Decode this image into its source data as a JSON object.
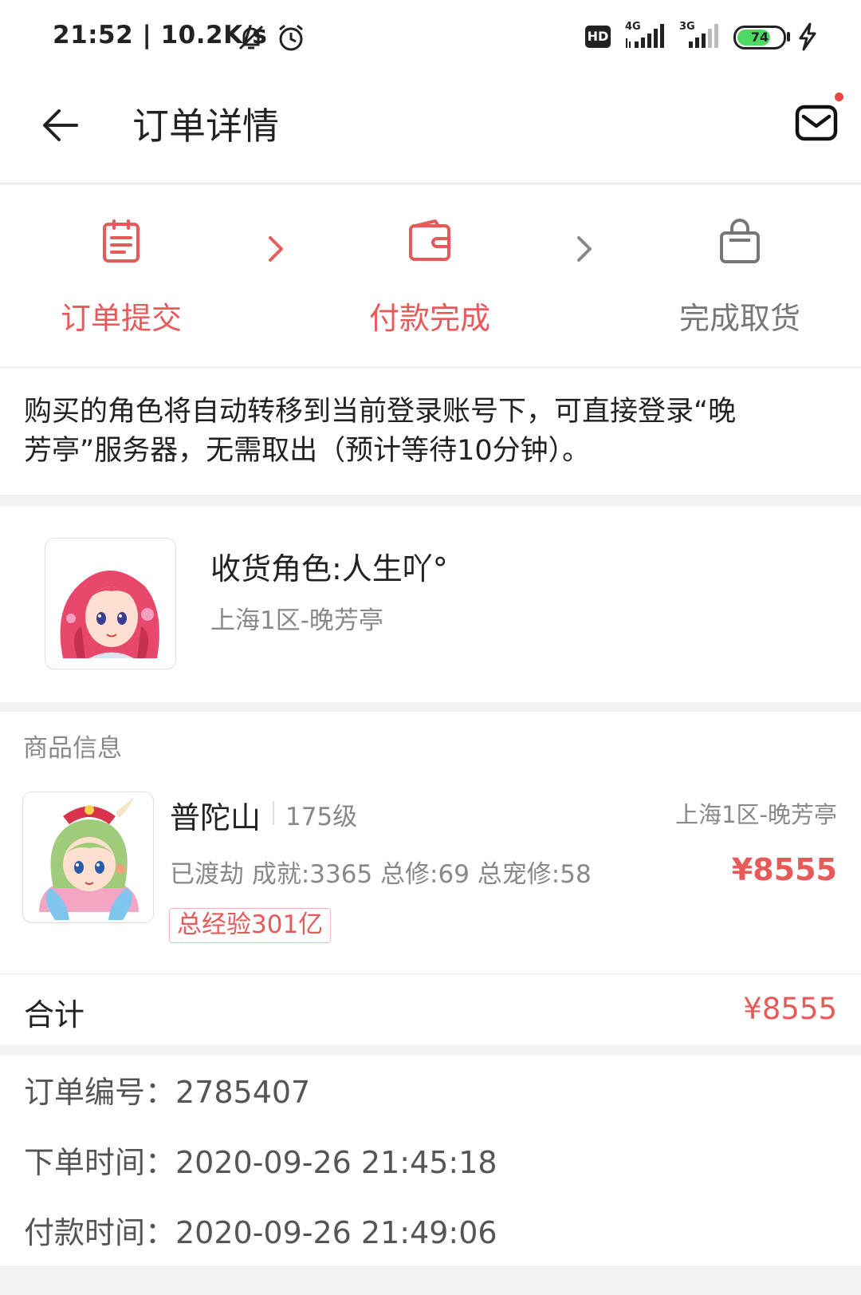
{
  "status_bar": {
    "time_speed": "21:52 | 10.2K/s",
    "battery": "74",
    "hd": "HD",
    "net1": "4G",
    "net2": "3G",
    "icons": [
      "mute-bell-icon",
      "alarm-icon",
      "hd-icon",
      "signal-4g-icon",
      "signal-3g-icon",
      "battery-icon",
      "charging-icon"
    ]
  },
  "header": {
    "title": "订单详情",
    "icons": [
      "back-arrow-icon",
      "mail-icon"
    ]
  },
  "steps": [
    {
      "label": "订单提交",
      "icon": "order-list-icon",
      "active": true
    },
    {
      "label": "付款完成",
      "icon": "wallet-icon",
      "active": true
    },
    {
      "label": "完成取货",
      "icon": "bag-icon",
      "active": false
    }
  ],
  "colors": {
    "accent": "#e85a5a",
    "muted": "#888888",
    "background": "#f2f2f2"
  },
  "notice": {
    "line1": "购买的角色将自动转移到当前登录账号下，可直接登录“晚",
    "line2": "芳亭”服务器，无需取出（预计等待10分钟）。"
  },
  "receiver": {
    "name": "收货角色:人生吖°",
    "server": "上海1区-晚芳亭"
  },
  "goods": {
    "section_title": "商品信息",
    "name": "普陀山",
    "level": "175级",
    "server": "上海1区-晚芳亭",
    "stats": "已渡劫 成就:3365 总修:69 总宠修:58",
    "price": "¥8555",
    "tag": "总经验301亿"
  },
  "total": {
    "label": "合计",
    "value": "¥8555"
  },
  "order": {
    "number": "订单编号：2785407",
    "created": "下单时间：2020-09-26 21:45:18",
    "paid": "付款时间：2020-09-26 21:49:06"
  }
}
